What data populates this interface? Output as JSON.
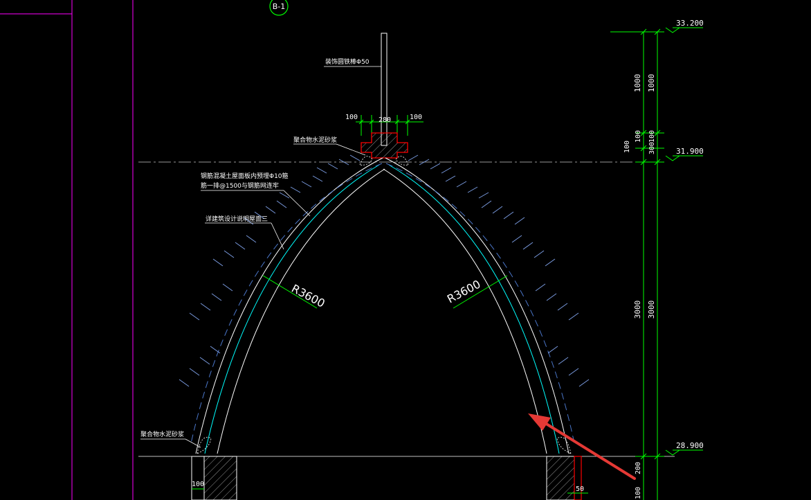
{
  "drawing": {
    "section_marker": "B-1",
    "elevations": {
      "top": "33.200",
      "mid": "31.900",
      "base": "28.900"
    },
    "dims_vertical_outer": [
      "1000",
      "100",
      "100",
      "3000",
      "200"
    ],
    "dims_vertical_inner": [
      "1000",
      "100",
      "300",
      "3000",
      "100"
    ],
    "dims_top": {
      "left": "100",
      "center": "280",
      "right": "100"
    },
    "dims_bottom": {
      "left": "100",
      "right": "50"
    },
    "radius_left": "R3600",
    "radius_right": "R3600",
    "labels": {
      "rod": "装饰圆铁棒Φ50",
      "mortar_top": "聚合物水泥砂浆",
      "steel_line1": "钢筋混凝土屋面板内预埋Φ10箍",
      "steel_line2": "筋一排@1500与钢筋网连牢",
      "roof_note": "详建筑设计说明屋面三",
      "mortar_bottom": "聚合物水泥砂浆"
    },
    "colors": {
      "background": "#000000",
      "dimension": "#00ff00",
      "outline": "#ffffff",
      "section_cut": "#ff0000",
      "axis": "#ff00ff",
      "layer": "#00ffff",
      "arrow": "#e53935"
    }
  }
}
